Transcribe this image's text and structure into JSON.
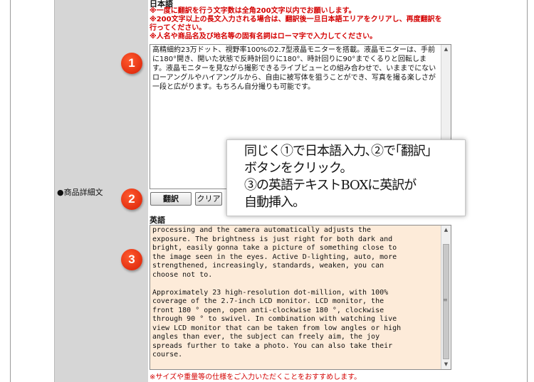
{
  "form": {
    "row_label": "●商品詳細文",
    "japanese": {
      "title": "日本語",
      "notes": [
        "※一度に翻訳を行う文字数は全角200文字以内でお願いします。",
        "※200文字以上の長文入力される場合は、翻訳後一旦日本語エリアをクリアし、再度翻訳を",
        "行ってください。",
        "※人名や商品名及び地名等の固有名詞はローマ字で入力してください。"
      ],
      "textarea_value": "高精細約23万ドット、視野率100%の2.7型液晶モニターを搭載。液晶モニターは、手前に180°開き、開いた状態で反時計回りに180°、時計回りに90°までくるりと回転します。液晶モニターを見ながら撮影できるライブビューとの組み合わせで、いままでにないローアングルやハイアングルから、自由に被写体を狙うことができ、写真を撮る楽しさが一段と広がります。もちろん自分撮りも可能です。"
    },
    "buttons": {
      "translate": "翻訳",
      "clear": "クリア"
    },
    "english": {
      "title": "英語",
      "textarea_value": "processing and the camera automatically adjusts the\nexposure. The brightness is just right for both dark and\nbright, easily gonna take a picture of something close to\nthe image seen in the eyes. Active D-lighting, auto, more\nstrengthened, increasingly, standards, weaken, you can\nchoose not to.\n\nApproximately 23 high-resolution dot-million, with 100%\ncoverage of the 2.7-inch LCD monitor. LCD monitor, the\nfront 180 ° open, open anti-clockwise 180 °, clockwise\nthrough 90 ° to swivel. In combination with watching live\nview LCD monitor that can be taken from low angles or high\nangles than ever, the subject can freely aim, the joy\nspreads further to take a photo. You can also take their\ncourse."
    },
    "bottom_note": "※サイズや重量等の仕様をご入力いただくことをおすすめします。"
  },
  "markers": [
    "1",
    "2",
    "3"
  ],
  "callout": {
    "lines": [
      "同じく①で日本語入力､②で｢翻訳｣",
      "ボタンをクリック。",
      "③の英語テキストBOXに英訳が",
      "自動挿入。"
    ]
  },
  "colors": {
    "label_column": "#d6d6d6",
    "note_red": "#d40000",
    "english_textarea_bg": "#fdebd9",
    "marker_red": "#e02a08"
  },
  "icons": {
    "scroll_up": "triangle-up",
    "scroll_down": "triangle-down"
  }
}
